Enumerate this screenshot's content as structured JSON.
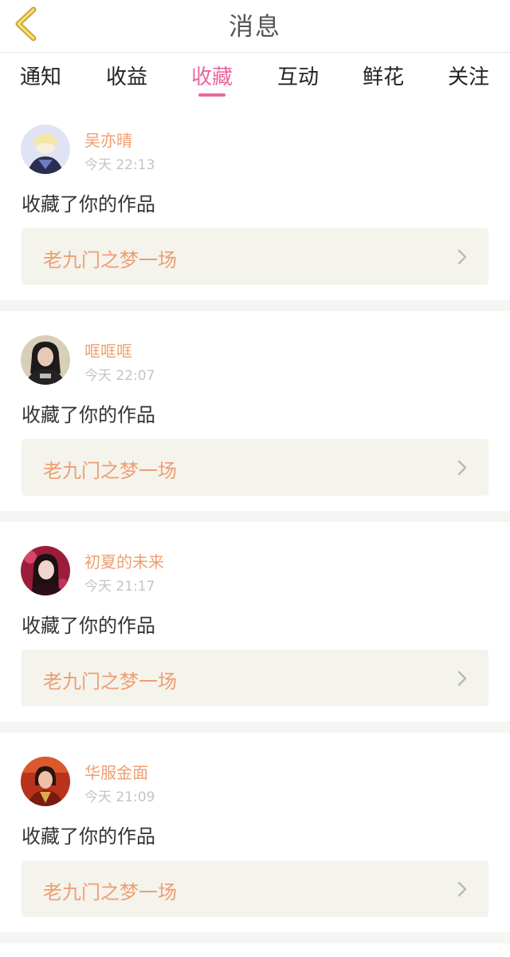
{
  "header": {
    "title": "消息",
    "back_icon": "chevron-left-icon"
  },
  "tabs": [
    {
      "label": "通知"
    },
    {
      "label": "收益"
    },
    {
      "label": "收藏",
      "active": true
    },
    {
      "label": "互动"
    },
    {
      "label": "鲜花"
    },
    {
      "label": "关注"
    }
  ],
  "messages": [
    {
      "username": "吴亦晴",
      "time": "今天 22:13",
      "action": "收藏了你的作品",
      "work_title": "老九门之梦一场"
    },
    {
      "username": "哐哐哐",
      "time": "今天 22:07",
      "action": "收藏了你的作品",
      "work_title": "老九门之梦一场"
    },
    {
      "username": "初夏的未来",
      "time": "今天 21:17",
      "action": "收藏了你的作品",
      "work_title": "老九门之梦一场"
    },
    {
      "username": "华服金面",
      "time": "今天 21:09",
      "action": "收藏了你的作品",
      "work_title": "老九门之梦一场"
    }
  ],
  "colors": {
    "accent_pink": "#e9679c",
    "name_orange": "#ee9f71",
    "back_yellow": "#f2c94c",
    "link_bg": "#f4f3ec"
  }
}
